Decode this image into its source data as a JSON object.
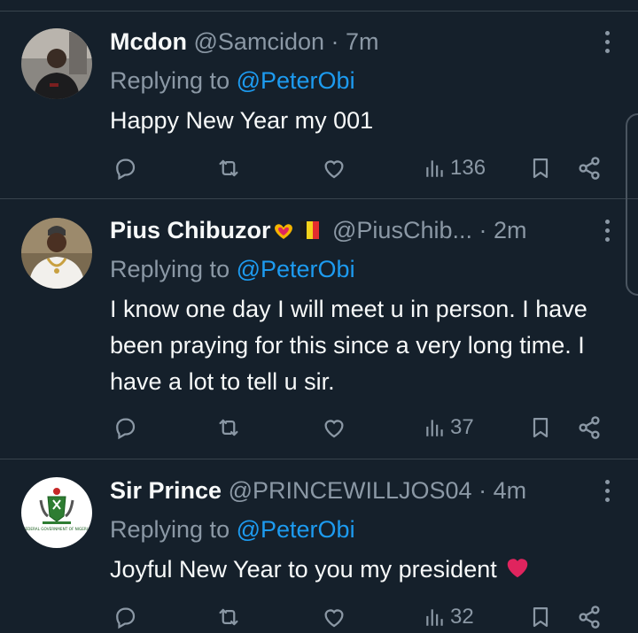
{
  "tweets": [
    {
      "name": "Mcdon",
      "handle": "@Samcidon",
      "separator": "·",
      "time": "7m",
      "replying_prefix": "Replying to",
      "replying_to": "@PeterObi",
      "text": "Happy New Year my 001",
      "views": "136"
    },
    {
      "name": "Pius Chibuzor",
      "handle": "@PiusChib...",
      "separator": "·",
      "time": "2m",
      "replying_prefix": "Replying to",
      "replying_to": "@PeterObi",
      "text": "I know one day I will meet u in person. I have been praying for this since a very long time. I have a lot to tell u sir.",
      "views": "37"
    },
    {
      "name": "Sir Prince",
      "handle": "@PRINCEWILLJOS04",
      "separator": "·",
      "time": "4m",
      "replying_prefix": "Replying to",
      "replying_to": "@PeterObi",
      "text": "Joyful New Year to you my president",
      "views": "32",
      "avatar_caption": "FEDERAL GOVERNMENT OF NIGERIA"
    }
  ],
  "icons": {
    "reply": "reply-icon",
    "retweet": "retweet-icon",
    "like": "like-icon",
    "views": "views-icon",
    "bookmark": "bookmark-icon",
    "share": "share-icon",
    "more": "more-options-icon"
  },
  "colors": {
    "background": "#15202b",
    "divider": "#38444d",
    "text": "#f7f9f9",
    "muted": "#8b98a5",
    "accent": "#1d9bf0",
    "heart": "#e0245e"
  }
}
